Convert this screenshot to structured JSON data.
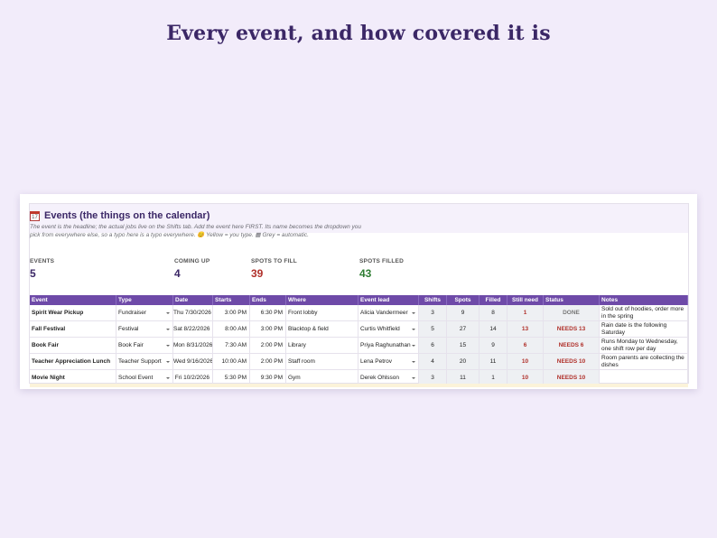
{
  "headline": "Every event, and how covered it is",
  "section": {
    "icon": "calendar-icon",
    "icon_glyph": "17",
    "title": "Events  (the things on the calendar)",
    "subtitle": "The event is the headline; the actual jobs live on the Shifts tab. Add the event here FIRST. Its name becomes the dropdown you pick from everywhere else, so a typo here is a typo everywhere.  😊  Yellow = you type.  ▦ Grey = automatic."
  },
  "stats": [
    {
      "label": "EVENTS",
      "value": "5",
      "color": "#3b2766"
    },
    {
      "label": "COMING UP",
      "value": "4",
      "color": "#3b2766"
    },
    {
      "label": "SPOTS TO FILL",
      "value": "39",
      "color": "#b0302a"
    },
    {
      "label": "SPOTS FILLED",
      "value": "43",
      "color": "#2e7d32"
    }
  ],
  "columns": [
    "Event",
    "Type",
    "Date",
    "Starts",
    "Ends",
    "Where",
    "Event lead",
    "Shifts",
    "Spots",
    "Filled",
    "Still need",
    "Status",
    "Notes"
  ],
  "rows": [
    {
      "event": "Spirit Wear Pickup",
      "type": "Fundraiser",
      "date": "Thu 7/30/2026",
      "starts": "3:00 PM",
      "ends": "6:30 PM",
      "where": "Front lobby",
      "lead": "Alicia Vandermeer",
      "shifts": "3",
      "spots": "9",
      "filled": "8",
      "still_need": "1",
      "status": "DONE",
      "notes": "Sold out of hoodies, order more in the spring"
    },
    {
      "event": "Fall Festival",
      "type": "Festival",
      "date": "Sat 8/22/2026",
      "starts": "8:00 AM",
      "ends": "3:00 PM",
      "where": "Blacktop & field",
      "lead": "Curtis Whitfield",
      "shifts": "5",
      "spots": "27",
      "filled": "14",
      "still_need": "13",
      "status": "NEEDS 13",
      "notes": "Rain date is the following Saturday"
    },
    {
      "event": "Book Fair",
      "type": "Book Fair",
      "date": "Mon 8/31/2026",
      "starts": "7:30 AM",
      "ends": "2:00 PM",
      "where": "Library",
      "lead": "Priya Raghunathan",
      "shifts": "6",
      "spots": "15",
      "filled": "9",
      "still_need": "6",
      "status": "NEEDS 6",
      "notes": "Runs Monday to Wednesday, one shift row per day"
    },
    {
      "event": "Teacher Appreciation Lunch",
      "type": "Teacher Support",
      "date": "Wed 9/16/2026",
      "starts": "10:00 AM",
      "ends": "2:00 PM",
      "where": "Staff room",
      "lead": "Lena Petrov",
      "shifts": "4",
      "spots": "20",
      "filled": "11",
      "still_need": "10",
      "status": "NEEDS 10",
      "notes": "Room parents are collecting the dishes"
    },
    {
      "event": "Movie Night",
      "type": "School Event",
      "date": "Fri 10/2/2026",
      "starts": "5:30 PM",
      "ends": "9:30 PM",
      "where": "Gym",
      "lead": "Derek Ohlsson",
      "shifts": "3",
      "spots": "11",
      "filled": "1",
      "still_need": "10",
      "status": "NEEDS 10",
      "notes": ""
    }
  ]
}
